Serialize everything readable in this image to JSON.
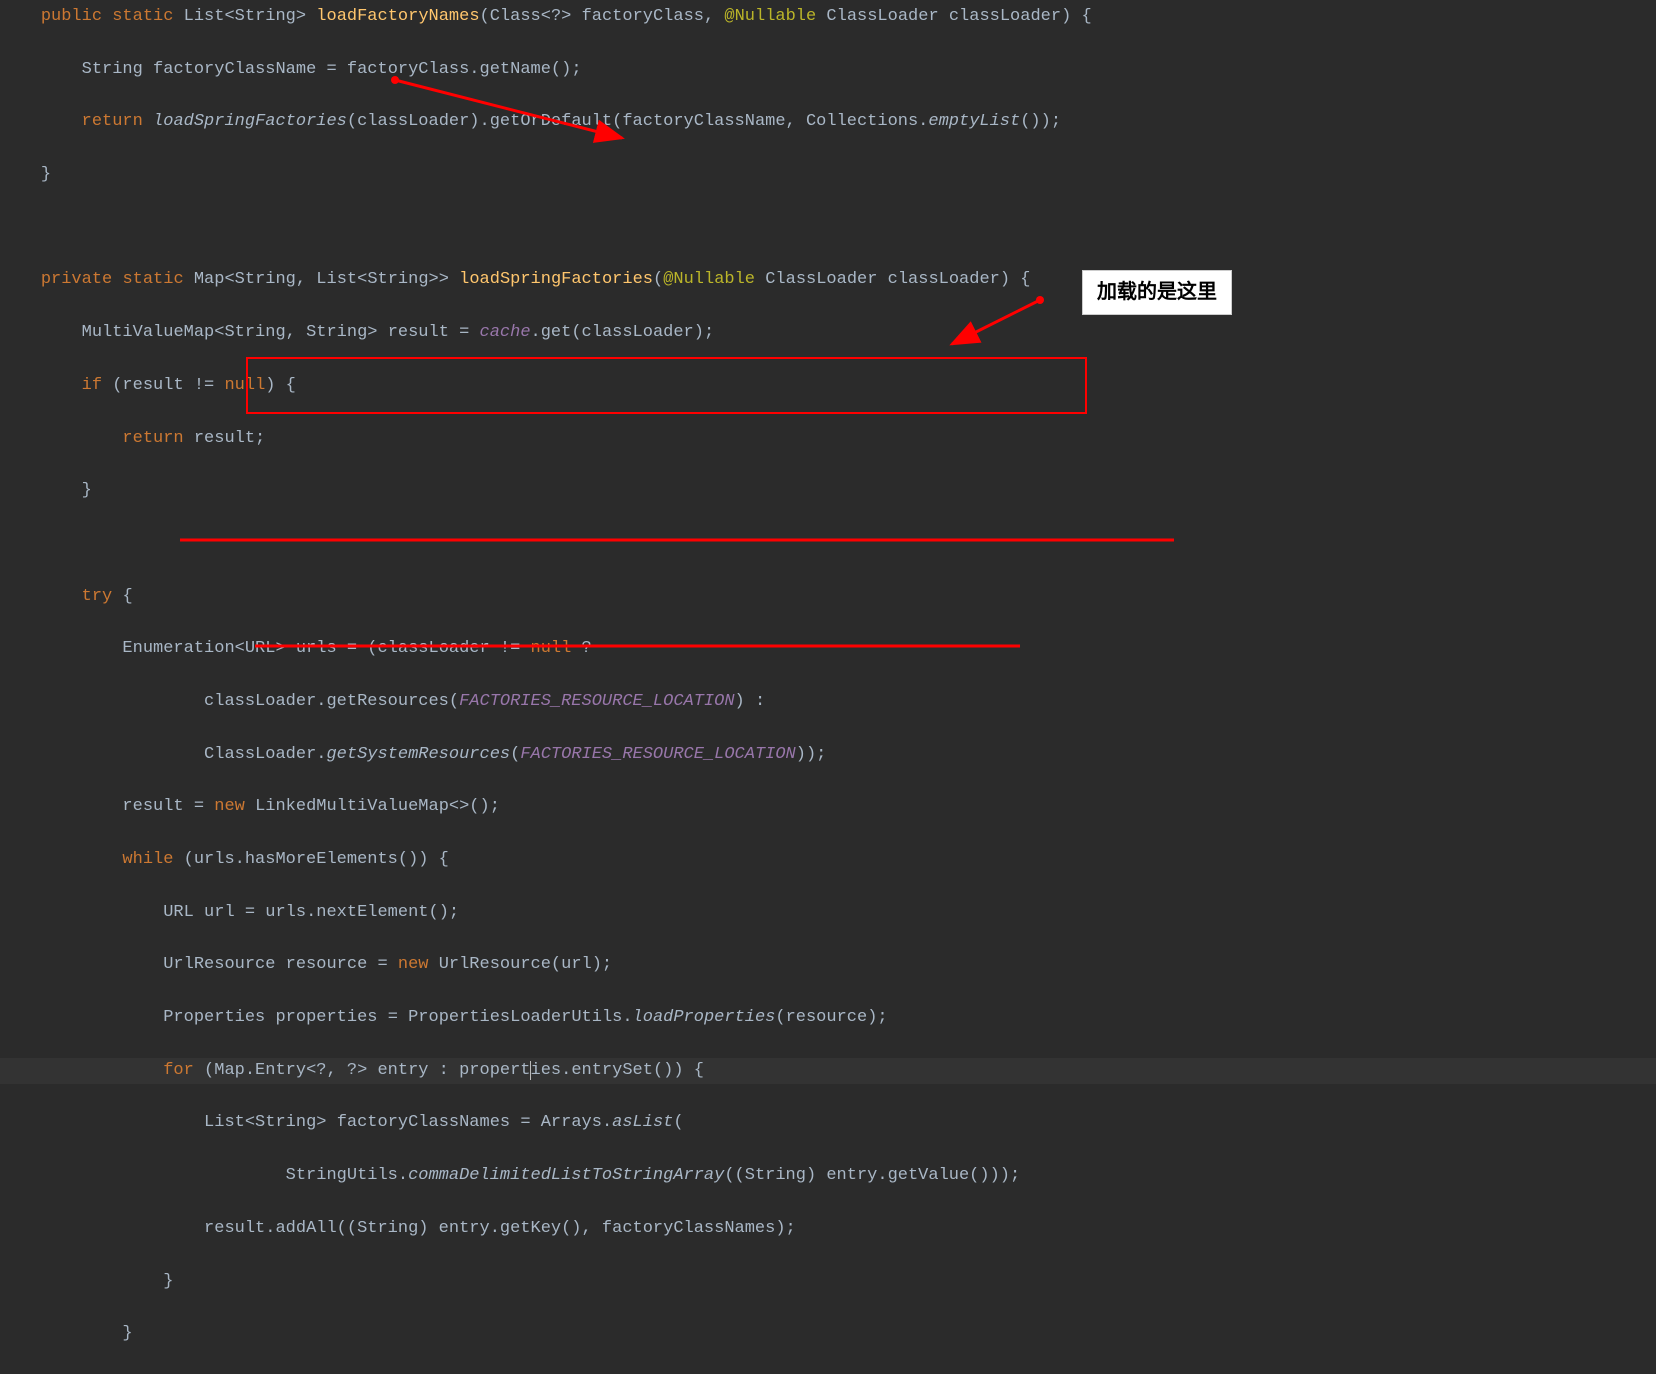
{
  "callout": {
    "text": "加载的是这里"
  },
  "code": {
    "l1": {
      "public": "public",
      "static": "static",
      "list": "List",
      "string": "String",
      "name": "loadFactoryNames",
      "class": "Class",
      "param2": "factoryClass,",
      "ann": "@Nullable",
      "cl": "ClassLoader",
      "clname": "classLoader",
      "brace": "{"
    },
    "l2": {
      "full": "String factoryClassName = factoryClass.getName();",
      "type": "String",
      "var": "factoryClassName",
      "eq": "=",
      "expr": "factoryClass.getName();"
    },
    "l3": {
      "ret": "return",
      "call": "loadSpringFactories",
      "rest1": "(classLoader).getOrDefault(factoryClassName, Collections.",
      "empty": "emptyList",
      "rest2": "());"
    },
    "l4": {
      "brace": "}"
    },
    "l6": {
      "priv": "private",
      "static": "static",
      "map": "Map",
      "string": "String",
      "list": "List",
      "name": "loadSpringFactories",
      "ann": "@Nullable",
      "cl": "ClassLoader",
      "clname": "classLoader",
      "brace": "{"
    },
    "l7": {
      "type": "MultiValueMap",
      "gen": "<String, String>",
      "var": "result",
      "eq": "=",
      "cache": "cache",
      "rest": ".get(classLoader);"
    },
    "l8": {
      "if": "if",
      "cond": "(result !=",
      "null": "null",
      "rest": ") {"
    },
    "l9": {
      "ret": "return",
      "rest": "result;"
    },
    "l10": {
      "brace": "}"
    },
    "l12": {
      "try": "try",
      "brace": "{"
    },
    "l13": {
      "type": "Enumeration",
      "gen": "<URL>",
      "var": "urls",
      "eq": "=",
      "expr": "(classLoader !=",
      "null": "null",
      "q": "?"
    },
    "l14": {
      "pre": "classLoader.getResources(",
      "field": "FACTORIES_RESOURCE_LOCATION",
      "post": ") :"
    },
    "l15": {
      "pre": "ClassLoader.",
      "call": "getSystemResources",
      "lp": "(",
      "field": "FACTORIES_RESOURCE_LOCATION",
      "post": "));"
    },
    "l16": {
      "var": "result",
      "eq": "=",
      "new": "new",
      "type": "LinkedMultiValueMap",
      "rest": "<>();"
    },
    "l17": {
      "while": "while",
      "cond": "(urls.hasMoreElements()) {"
    },
    "l18": {
      "type": "URL",
      "var": "url",
      "eq": "=",
      "expr": "urls.nextElement();"
    },
    "l19": {
      "type": "UrlResource",
      "var": "resource",
      "eq": "=",
      "new": "new",
      "ctor": "UrlResource",
      "rest": "(url);"
    },
    "l20": {
      "type": "Properties",
      "var": "properties",
      "eq": "=",
      "pre": "PropertiesLoaderUtils.",
      "call": "loadProperties",
      "rest": "(resource);"
    },
    "l21": {
      "for": "for",
      "lp": "(Map.Entry<?, ?> entry :",
      "propA": "propert",
      "propB": "ies",
      "rest": ".entrySet()) {"
    },
    "l22": {
      "type": "List",
      "gen": "<String>",
      "var": "factoryClassNames",
      "eq": "=",
      "pre": "Arrays.",
      "call": "asList",
      "rest": "("
    },
    "l23": {
      "pre": "StringUtils.",
      "call": "commaDelimitedListToStringArray",
      "rest": "((String) entry.getValue()));"
    },
    "l24": {
      "expr": "result.addAll((String) entry.getKey(), factoryClassNames);"
    },
    "l25": {
      "brace": "}"
    },
    "l26": {
      "brace": "}"
    }
  }
}
